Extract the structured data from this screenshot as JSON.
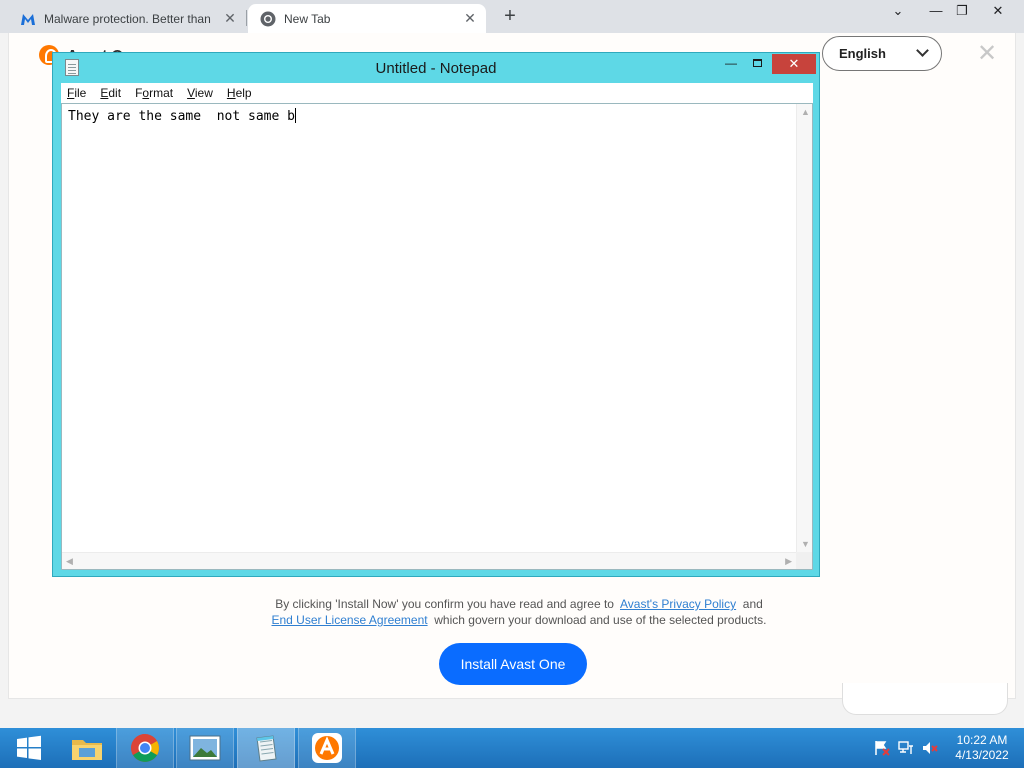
{
  "browser": {
    "tabs": [
      {
        "title": "Malware protection. Better than",
        "icon": "malwarebytes-icon",
        "active": false
      },
      {
        "title": "New Tab",
        "icon": "chrome-icon",
        "active": true
      }
    ],
    "new_tab_symbol": "+",
    "window_controls": {
      "tab_search": "⌄",
      "minimize": "—",
      "restore": "❐",
      "close": "✕"
    }
  },
  "avast_page": {
    "heading": "Avast One",
    "language_select": "English",
    "close_symbol": "✕",
    "consent_prefix": "By clicking 'Install Now' you confirm you have read and agree to",
    "privacy_link": "Avast's Privacy Policy",
    "consent_and": "and",
    "eula_link": "End User License Agreement",
    "consent_suffix": "which govern your download and use of the selected products.",
    "install_button": "Install Avast One",
    "accent_color": "#ff7800",
    "button_color": "#0a6cff"
  },
  "notepad": {
    "title": "Untitled - Notepad",
    "minimize_symbol": "—",
    "close_symbol": "✕",
    "menu": [
      {
        "label": "File",
        "hotkey": "F",
        "rest": "ile"
      },
      {
        "label": "Edit",
        "hotkey": "E",
        "rest": "dit"
      },
      {
        "label": "Format",
        "hotkey": "o",
        "pre": "F",
        "rest": "rmat"
      },
      {
        "label": "View",
        "hotkey": "V",
        "rest": "iew"
      },
      {
        "label": "Help",
        "hotkey": "H",
        "rest": "elp"
      }
    ],
    "content": "They are the same  not same b",
    "frame_color": "#5ed8e6"
  },
  "taskbar": {
    "apps": [
      {
        "name": "file-explorer"
      },
      {
        "name": "chrome"
      },
      {
        "name": "photo-viewer"
      },
      {
        "name": "notepad",
        "active": true
      },
      {
        "name": "avast"
      }
    ],
    "clock": {
      "time": "10:22 AM",
      "date": "4/13/2022"
    }
  }
}
